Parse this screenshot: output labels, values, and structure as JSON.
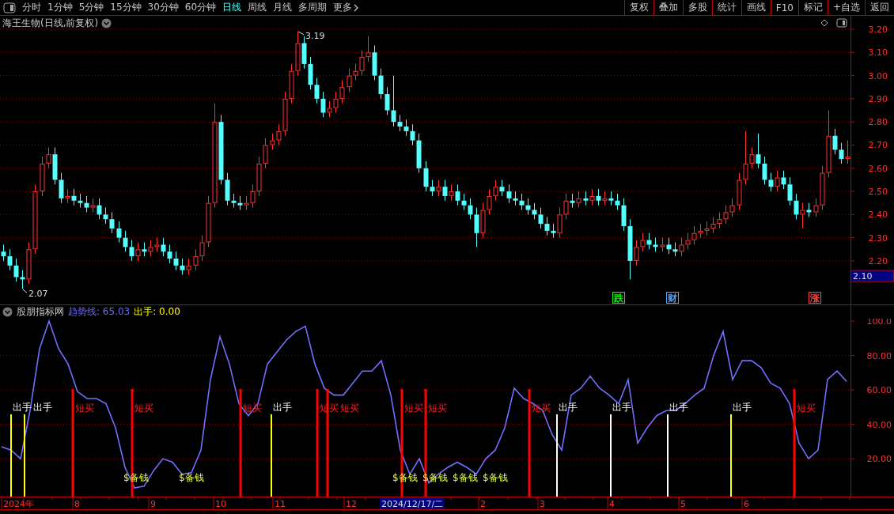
{
  "toolbar": {
    "periods": [
      {
        "label": "分时",
        "selected": false,
        "kind": "period"
      },
      {
        "label": "1分钟",
        "selected": false,
        "kind": "period"
      },
      {
        "label": "5分钟",
        "selected": false,
        "kind": "period"
      },
      {
        "label": "15分钟",
        "selected": false,
        "kind": "period"
      },
      {
        "label": "30分钟",
        "selected": false,
        "kind": "period"
      },
      {
        "label": "60分钟",
        "selected": false,
        "kind": "period"
      },
      {
        "label": "日线",
        "selected": true,
        "kind": "period"
      },
      {
        "label": "周线",
        "selected": false,
        "kind": "period"
      },
      {
        "label": "月线",
        "selected": false,
        "kind": "period"
      },
      {
        "label": "多周期",
        "selected": false,
        "kind": "period"
      },
      {
        "label": "更多",
        "selected": false,
        "kind": "menu"
      }
    ],
    "actions": [
      "复权",
      "叠加",
      "多股",
      "统计",
      "画线",
      "F10",
      "标记",
      "+自选",
      "返回"
    ]
  },
  "price_panel": {
    "title": "海王生物(日线,前复权)",
    "current_price": "2.10",
    "high_marker": "3.19",
    "low_marker": "2.07",
    "events": [
      {
        "label": "跌",
        "color": "#00ff00"
      },
      {
        "label": "财",
        "color": "#5aa0ff"
      },
      {
        "label": "涨",
        "color": "#ff4040"
      }
    ],
    "chart_data": {
      "type": "candlestick",
      "grid": true,
      "ylim": [
        2.012,
        3.258
      ],
      "yticks": [
        {
          "value": 3.2,
          "label": "3.20"
        },
        {
          "value": 3.1,
          "label": "3.10"
        },
        {
          "value": 3.0,
          "label": "3.00"
        },
        {
          "value": 2.9,
          "label": "2.90"
        },
        {
          "value": 2.8,
          "label": "2.80"
        },
        {
          "value": 2.7,
          "label": "2.70"
        },
        {
          "value": 2.6,
          "label": "2.60"
        },
        {
          "value": 2.5,
          "label": "2.50"
        },
        {
          "value": 2.4,
          "label": "2.40"
        },
        {
          "value": 2.3,
          "label": "2.30"
        },
        {
          "value": 2.2,
          "label": "2.20"
        }
      ],
      "ohlc": [
        [
          2.24,
          2.27,
          2.2,
          2.22
        ],
        [
          2.22,
          2.25,
          2.16,
          2.18
        ],
        [
          2.18,
          2.21,
          2.11,
          2.13
        ],
        [
          2.13,
          2.16,
          2.08,
          2.12
        ],
        [
          2.12,
          2.28,
          2.1,
          2.25
        ],
        [
          2.25,
          2.53,
          2.23,
          2.5
        ],
        [
          2.5,
          2.65,
          2.48,
          2.62
        ],
        [
          2.62,
          2.69,
          2.6,
          2.66
        ],
        [
          2.66,
          2.69,
          2.53,
          2.55
        ],
        [
          2.55,
          2.58,
          2.45,
          2.47
        ],
        [
          2.47,
          2.51,
          2.45,
          2.48
        ],
        [
          2.48,
          2.51,
          2.44,
          2.46
        ],
        [
          2.46,
          2.49,
          2.43,
          2.45
        ],
        [
          2.45,
          2.48,
          2.41,
          2.43
        ],
        [
          2.43,
          2.47,
          2.41,
          2.44
        ],
        [
          2.44,
          2.47,
          2.38,
          2.4
        ],
        [
          2.4,
          2.43,
          2.36,
          2.38
        ],
        [
          2.38,
          2.41,
          2.32,
          2.34
        ],
        [
          2.34,
          2.37,
          2.28,
          2.3
        ],
        [
          2.3,
          2.33,
          2.24,
          2.26
        ],
        [
          2.26,
          2.29,
          2.2,
          2.22
        ],
        [
          2.22,
          2.28,
          2.2,
          2.25
        ],
        [
          2.25,
          2.28,
          2.22,
          2.24
        ],
        [
          2.24,
          2.29,
          2.22,
          2.26
        ],
        [
          2.26,
          2.3,
          2.24,
          2.27
        ],
        [
          2.27,
          2.3,
          2.22,
          2.24
        ],
        [
          2.24,
          2.27,
          2.19,
          2.21
        ],
        [
          2.21,
          2.24,
          2.16,
          2.18
        ],
        [
          2.18,
          2.21,
          2.14,
          2.16
        ],
        [
          2.16,
          2.21,
          2.14,
          2.18
        ],
        [
          2.18,
          2.25,
          2.16,
          2.22
        ],
        [
          2.22,
          2.31,
          2.2,
          2.28
        ],
        [
          2.28,
          2.48,
          2.26,
          2.45
        ],
        [
          2.45,
          2.88,
          2.43,
          2.8
        ],
        [
          2.8,
          2.83,
          2.53,
          2.55
        ],
        [
          2.55,
          2.58,
          2.44,
          2.46
        ],
        [
          2.46,
          2.49,
          2.43,
          2.45
        ],
        [
          2.45,
          2.48,
          2.42,
          2.44
        ],
        [
          2.44,
          2.48,
          2.42,
          2.45
        ],
        [
          2.45,
          2.53,
          2.43,
          2.5
        ],
        [
          2.5,
          2.65,
          2.48,
          2.62
        ],
        [
          2.62,
          2.73,
          2.6,
          2.7
        ],
        [
          2.7,
          2.75,
          2.68,
          2.72
        ],
        [
          2.72,
          2.79,
          2.7,
          2.76
        ],
        [
          2.76,
          2.93,
          2.74,
          2.9
        ],
        [
          2.9,
          3.05,
          2.88,
          3.02
        ],
        [
          3.02,
          3.19,
          3.0,
          3.14
        ],
        [
          3.14,
          3.17,
          3.03,
          3.05
        ],
        [
          3.05,
          3.08,
          2.94,
          2.96
        ],
        [
          2.96,
          2.99,
          2.88,
          2.9
        ],
        [
          2.9,
          2.93,
          2.82,
          2.84
        ],
        [
          2.84,
          2.89,
          2.82,
          2.86
        ],
        [
          2.86,
          2.93,
          2.84,
          2.9
        ],
        [
          2.9,
          2.98,
          2.88,
          2.95
        ],
        [
          2.95,
          3.03,
          2.93,
          3.0
        ],
        [
          3.0,
          3.05,
          2.98,
          3.02
        ],
        [
          3.02,
          3.11,
          3.0,
          3.08
        ],
        [
          3.08,
          3.17,
          3.06,
          3.1
        ],
        [
          3.1,
          3.13,
          2.98,
          3.0
        ],
        [
          3.0,
          3.03,
          2.9,
          2.92
        ],
        [
          2.92,
          2.95,
          2.83,
          2.85
        ],
        [
          2.85,
          3.0,
          2.78,
          2.8
        ],
        [
          2.8,
          2.83,
          2.76,
          2.78
        ],
        [
          2.78,
          2.81,
          2.74,
          2.76
        ],
        [
          2.76,
          2.79,
          2.7,
          2.72
        ],
        [
          2.72,
          2.75,
          2.58,
          2.6
        ],
        [
          2.6,
          2.63,
          2.5,
          2.52
        ],
        [
          2.52,
          2.55,
          2.48,
          2.5
        ],
        [
          2.5,
          2.55,
          2.48,
          2.52
        ],
        [
          2.52,
          2.55,
          2.46,
          2.48
        ],
        [
          2.48,
          2.53,
          2.46,
          2.5
        ],
        [
          2.5,
          2.53,
          2.44,
          2.46
        ],
        [
          2.46,
          2.49,
          2.42,
          2.44
        ],
        [
          2.44,
          2.47,
          2.38,
          2.4
        ],
        [
          2.4,
          2.43,
          2.26,
          2.32
        ],
        [
          2.32,
          2.45,
          2.3,
          2.42
        ],
        [
          2.42,
          2.51,
          2.4,
          2.48
        ],
        [
          2.48,
          2.55,
          2.46,
          2.52
        ],
        [
          2.52,
          2.55,
          2.48,
          2.5
        ],
        [
          2.5,
          2.53,
          2.45,
          2.47
        ],
        [
          2.47,
          2.5,
          2.44,
          2.46
        ],
        [
          2.46,
          2.49,
          2.42,
          2.44
        ],
        [
          2.44,
          2.47,
          2.4,
          2.42
        ],
        [
          2.42,
          2.45,
          2.38,
          2.4
        ],
        [
          2.4,
          2.43,
          2.34,
          2.36
        ],
        [
          2.36,
          2.39,
          2.31,
          2.33
        ],
        [
          2.33,
          2.36,
          2.3,
          2.32
        ],
        [
          2.32,
          2.43,
          2.3,
          2.4
        ],
        [
          2.4,
          2.49,
          2.38,
          2.46
        ],
        [
          2.46,
          2.49,
          2.43,
          2.45
        ],
        [
          2.45,
          2.5,
          2.43,
          2.47
        ],
        [
          2.47,
          2.5,
          2.44,
          2.46
        ],
        [
          2.46,
          2.51,
          2.44,
          2.48
        ],
        [
          2.48,
          2.51,
          2.44,
          2.46
        ],
        [
          2.46,
          2.5,
          2.44,
          2.47
        ],
        [
          2.47,
          2.5,
          2.44,
          2.46
        ],
        [
          2.46,
          2.49,
          2.42,
          2.44
        ],
        [
          2.44,
          2.47,
          2.33,
          2.35
        ],
        [
          2.35,
          2.38,
          2.12,
          2.2
        ],
        [
          2.2,
          2.29,
          2.18,
          2.26
        ],
        [
          2.26,
          2.32,
          2.24,
          2.29
        ],
        [
          2.29,
          2.32,
          2.25,
          2.27
        ],
        [
          2.27,
          2.3,
          2.24,
          2.26
        ],
        [
          2.26,
          2.3,
          2.24,
          2.27
        ],
        [
          2.27,
          2.3,
          2.23,
          2.25
        ],
        [
          2.25,
          2.28,
          2.22,
          2.24
        ],
        [
          2.24,
          2.3,
          2.22,
          2.27
        ],
        [
          2.27,
          2.32,
          2.25,
          2.29
        ],
        [
          2.29,
          2.35,
          2.27,
          2.32
        ],
        [
          2.32,
          2.36,
          2.3,
          2.33
        ],
        [
          2.33,
          2.37,
          2.31,
          2.34
        ],
        [
          2.34,
          2.39,
          2.32,
          2.36
        ],
        [
          2.36,
          2.41,
          2.34,
          2.38
        ],
        [
          2.38,
          2.44,
          2.36,
          2.41
        ],
        [
          2.41,
          2.47,
          2.39,
          2.44
        ],
        [
          2.44,
          2.58,
          2.42,
          2.55
        ],
        [
          2.55,
          2.76,
          2.53,
          2.62
        ],
        [
          2.62,
          2.69,
          2.6,
          2.66
        ],
        [
          2.66,
          2.75,
          2.6,
          2.62
        ],
        [
          2.62,
          2.65,
          2.53,
          2.55
        ],
        [
          2.55,
          2.58,
          2.5,
          2.52
        ],
        [
          2.52,
          2.59,
          2.5,
          2.56
        ],
        [
          2.56,
          2.59,
          2.51,
          2.53
        ],
        [
          2.53,
          2.56,
          2.44,
          2.46
        ],
        [
          2.46,
          2.49,
          2.38,
          2.4
        ],
        [
          2.4,
          2.45,
          2.34,
          2.42
        ],
        [
          2.42,
          2.45,
          2.39,
          2.41
        ],
        [
          2.41,
          2.47,
          2.39,
          2.44
        ],
        [
          2.44,
          2.61,
          2.42,
          2.58
        ],
        [
          2.58,
          2.85,
          2.56,
          2.74
        ],
        [
          2.74,
          2.77,
          2.66,
          2.68
        ],
        [
          2.68,
          2.71,
          2.62,
          2.64
        ],
        [
          2.64,
          2.72,
          2.62,
          2.65
        ]
      ]
    }
  },
  "indicator": {
    "name": "股朋指标网",
    "readouts": [
      {
        "label": "趋势线: 65.03",
        "color": "#6a6aff"
      },
      {
        "label": "出手: 0.00",
        "color": "#ffff00"
      }
    ],
    "chart_data": {
      "type": "line",
      "grid": true,
      "ylim": [
        -2,
        101.4
      ],
      "yticks": [
        {
          "value": 100,
          "label": "100.0"
        },
        {
          "value": 80,
          "label": "80.00"
        },
        {
          "value": 60,
          "label": "60.00"
        },
        {
          "value": 40,
          "label": "40.00"
        },
        {
          "value": 20,
          "label": "20.00"
        }
      ],
      "series": [
        {
          "color": "#7070ff",
          "values": [
            27,
            25,
            20,
            48,
            84,
            100,
            84,
            75,
            59,
            55,
            55,
            52,
            38,
            15,
            3,
            4,
            13,
            20,
            18,
            11,
            12,
            25,
            66,
            91,
            75,
            52,
            45,
            52,
            75,
            82,
            89,
            94,
            97,
            75,
            61,
            57,
            57,
            64,
            71,
            71,
            77,
            57,
            25,
            11,
            20,
            6,
            11,
            15,
            18,
            15,
            11,
            20,
            25,
            38,
            61,
            55,
            52,
            48,
            34,
            25,
            57,
            61,
            68,
            61,
            57,
            52,
            66,
            29,
            38,
            45,
            48,
            48,
            52,
            57,
            61,
            80,
            94,
            66,
            77,
            77,
            73,
            64,
            61,
            52,
            29,
            20,
            25,
            66,
            71,
            65
          ]
        }
      ]
    },
    "signals": [
      {
        "kind": "sell",
        "label": "出手",
        "color": "#ffff00"
      },
      {
        "kind": "sell",
        "label": "出手",
        "color": "#ffff00"
      },
      {
        "kind": "buy",
        "label": "短买"
      },
      {
        "kind": "buy",
        "label": "短买"
      },
      {
        "kind": "buy",
        "label": "短买"
      },
      {
        "kind": "sell",
        "label": "出手",
        "color": "#ffff00"
      },
      {
        "kind": "buy",
        "label": "短买"
      },
      {
        "kind": "buy",
        "label": "短买"
      },
      {
        "kind": "buy",
        "label": "短买"
      },
      {
        "kind": "buy",
        "label": "短买"
      },
      {
        "kind": "buy",
        "label": "短买"
      },
      {
        "kind": "sell",
        "label": "出手",
        "color": "#ffffff"
      },
      {
        "kind": "sell",
        "label": "出手",
        "color": "#ffffff"
      },
      {
        "kind": "sell",
        "label": "出手",
        "color": "#ffffff"
      },
      {
        "kind": "sell",
        "label": "出手",
        "color": "#ffff00"
      },
      {
        "kind": "buy",
        "label": "短买"
      },
      {
        "kind": "cash",
        "label": "$备钱"
      },
      {
        "kind": "cash",
        "label": "$备钱"
      },
      {
        "kind": "cash",
        "label": "$备钱"
      },
      {
        "kind": "cash",
        "label": "$备钱"
      },
      {
        "kind": "cash",
        "label": "$备钱"
      },
      {
        "kind": "cash",
        "label": "$备钱"
      }
    ]
  },
  "date_axis": {
    "labels": [
      "2024年",
      "8",
      "9",
      "10",
      "11",
      "12",
      "2",
      "3",
      "4",
      "5",
      "6"
    ],
    "cursor_label": "2024/12/17/二"
  }
}
